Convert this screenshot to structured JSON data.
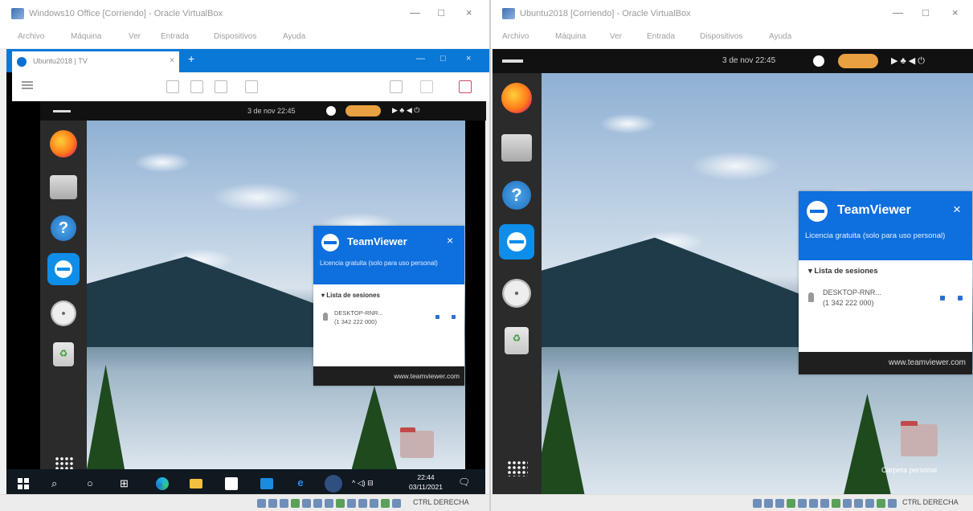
{
  "left_window": {
    "title": "Windows10 Office [Corriendo] - Oracle VirtualBox",
    "menu": [
      "Archivo",
      "Máquina",
      "Ver",
      "Entrada",
      "Dispositivos",
      "Ayuda"
    ],
    "status_key": "CTRL DERECHA",
    "browser": {
      "tab_label": "Ubuntu2018 | TV",
      "tab_close": "×",
      "new_tab": "+",
      "controls": [
        "—",
        "□",
        "×"
      ]
    },
    "ubuntu": {
      "date": "3 de nov 22:45",
      "tray": "▶ ♣ ◀ ⏻"
    },
    "teamviewer": {
      "brand": "TeamViewer",
      "close": "×",
      "license": "Licencia gratuita (solo para uso personal)",
      "sessions_title": "▾  Lista de sesiones",
      "device_name": "DESKTOP-RNR...",
      "device_id": "(1 342 222 000)",
      "footer": "www.teamviewer.com"
    },
    "taskbar": {
      "icons": [
        "⌕",
        "○",
        "⊞"
      ],
      "tray": "^ ◁) ⊟",
      "time": "22:44",
      "date": "03/11/2021",
      "notify": "🗨"
    }
  },
  "right_window": {
    "title": "Ubuntu2018 [Corriendo] - Oracle VirtualBox",
    "menu": [
      "Archivo",
      "Máquina",
      "Ver",
      "Entrada",
      "Dispositivos",
      "Ayuda"
    ],
    "status_key": "CTRL DERECHA",
    "ubuntu": {
      "date": "3 de nov 22:45",
      "tray": "▶ ♣ ◀ ⏻"
    },
    "teamviewer": {
      "brand": "TeamViewer",
      "close": "×",
      "license": "Licencia gratuita (solo para uso personal)",
      "sessions_title": "▾  Lista de sesiones",
      "device_name": "DESKTOP-RNR...",
      "device_id": "(1 342 222 000)",
      "footer": "www.teamviewer.com"
    },
    "desktop_folder": "Carpeta personal"
  },
  "window_controls": [
    "—",
    "□",
    "×"
  ]
}
